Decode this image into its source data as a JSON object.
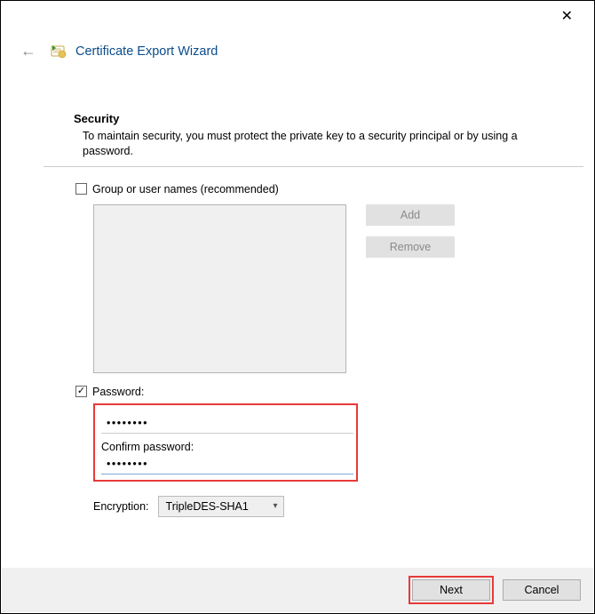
{
  "window": {
    "close_glyph": "✕"
  },
  "header": {
    "back_glyph": "←",
    "title": "Certificate Export Wizard"
  },
  "security": {
    "heading": "Security",
    "description": "To maintain security, you must protect the private key to a security principal or by using a password."
  },
  "group": {
    "checkbox_checked": false,
    "label": "Group or user names (recommended)",
    "add_label": "Add",
    "remove_label": "Remove"
  },
  "password": {
    "checkbox_checked": true,
    "label": "Password:",
    "value": "••••••••",
    "confirm_label": "Confirm password:",
    "confirm_value": "••••••••"
  },
  "encryption": {
    "label": "Encryption:",
    "selected": "TripleDES-SHA1"
  },
  "footer": {
    "next": "Next",
    "cancel": "Cancel"
  }
}
